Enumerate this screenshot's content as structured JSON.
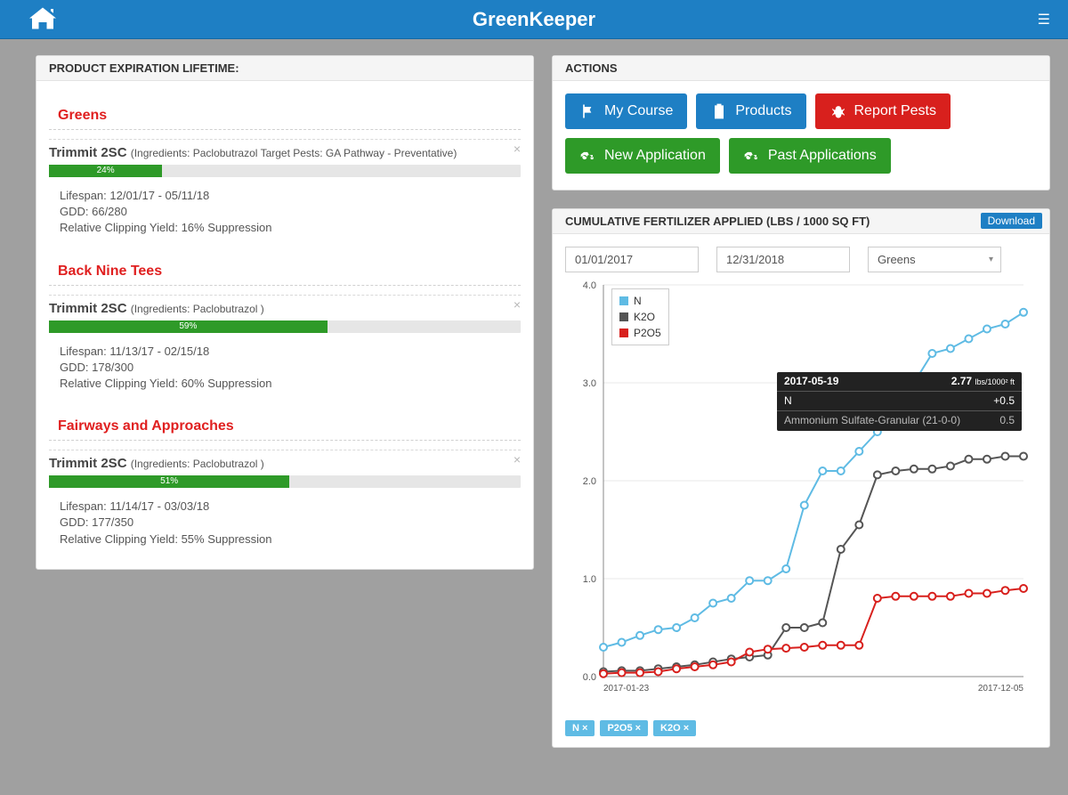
{
  "app": {
    "title": "GreenKeeper"
  },
  "expiration_panel": {
    "title": "PRODUCT EXPIRATION LIFETIME:",
    "groups": [
      {
        "name": "Greens",
        "products": [
          {
            "name": "Trimmit 2SC",
            "details": "(Ingredients: Paclobutrazol Target Pests: GA Pathway - Preventative)",
            "pct": 24,
            "pct_label": "24%",
            "lifespan": "Lifespan: 12/01/17 - 05/11/18",
            "gdd": "GDD: 66/280",
            "yield": "Relative Clipping Yield: 16% Suppression"
          }
        ]
      },
      {
        "name": "Back Nine Tees",
        "products": [
          {
            "name": "Trimmit 2SC",
            "details": "(Ingredients: Paclobutrazol )",
            "pct": 59,
            "pct_label": "59%",
            "lifespan": "Lifespan: 11/13/17 - 02/15/18",
            "gdd": "GDD: 178/300",
            "yield": "Relative Clipping Yield: 60% Suppression"
          }
        ]
      },
      {
        "name": "Fairways and Approaches",
        "products": [
          {
            "name": "Trimmit 2SC",
            "details": "(Ingredients: Paclobutrazol )",
            "pct": 51,
            "pct_label": "51%",
            "lifespan": "Lifespan: 11/14/17 - 03/03/18",
            "gdd": "GDD: 177/350",
            "yield": "Relative Clipping Yield: 55% Suppression"
          }
        ]
      }
    ]
  },
  "actions_panel": {
    "title": "ACTIONS",
    "buttons": {
      "my_course": "My Course",
      "products": "Products",
      "report_pests": "Report Pests",
      "new_app": "New Application",
      "past_apps": "Past Applications"
    }
  },
  "fert_panel": {
    "title": "CUMULATIVE FERTILIZER APPLIED (LBS / 1000 SQ FT)",
    "download": "Download",
    "date_from": "01/01/2017",
    "date_to": "12/31/2018",
    "area": "Greens",
    "legend": {
      "n": "N",
      "k2o": "K2O",
      "p2o5": "P2O5"
    },
    "x_start": "2017-01-23",
    "x_end": "2017-12-05",
    "tooltip": {
      "date": "2017-05-19",
      "total": "2.77",
      "unit_top": "lbs",
      "unit_bot": "/1000² ft",
      "series": "N",
      "delta": "+0.5",
      "note": "Ammonium Sulfate-Granular (21-0-0)",
      "note_val": "0.5"
    },
    "tags": {
      "n": "N ×",
      "p2o5": "P2O5 ×",
      "k2o": "K2O ×"
    }
  },
  "chart_data": {
    "type": "line",
    "title": "Cumulative Fertilizer Applied (lbs / 1000 sq ft)",
    "xlabel": "",
    "ylabel": "",
    "ylim": [
      0,
      4.0
    ],
    "x": [
      0,
      1,
      2,
      3,
      4,
      5,
      6,
      7,
      8,
      9,
      10,
      11,
      12,
      13,
      14,
      15,
      16,
      17,
      18,
      19,
      20,
      21,
      22,
      23
    ],
    "x_tick_labels": {
      "0": "2017-01-23",
      "23": "2017-12-05"
    },
    "series": [
      {
        "name": "N",
        "color": "#5fbbe4",
        "values": [
          0.3,
          0.35,
          0.42,
          0.48,
          0.5,
          0.6,
          0.75,
          0.8,
          0.98,
          0.98,
          1.1,
          1.75,
          2.1,
          2.1,
          2.3,
          2.5,
          2.78,
          3.0,
          3.3,
          3.35,
          3.45,
          3.55,
          3.6,
          3.72
        ]
      },
      {
        "name": "K2O",
        "color": "#555555",
        "values": [
          0.05,
          0.06,
          0.06,
          0.08,
          0.1,
          0.12,
          0.15,
          0.18,
          0.2,
          0.22,
          0.5,
          0.5,
          0.55,
          1.3,
          1.55,
          2.06,
          2.1,
          2.12,
          2.12,
          2.15,
          2.22,
          2.22,
          2.25,
          2.25
        ]
      },
      {
        "name": "P2O5",
        "color": "#d8201d",
        "values": [
          0.03,
          0.04,
          0.04,
          0.05,
          0.08,
          0.1,
          0.12,
          0.15,
          0.25,
          0.28,
          0.29,
          0.3,
          0.32,
          0.32,
          0.32,
          0.8,
          0.82,
          0.82,
          0.82,
          0.82,
          0.85,
          0.85,
          0.88,
          0.9
        ]
      }
    ]
  }
}
